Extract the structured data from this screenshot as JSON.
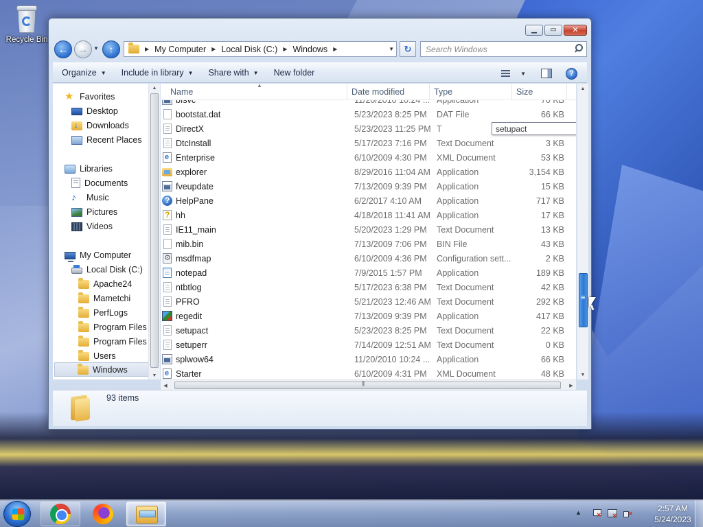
{
  "desktop": {
    "recycle_bin_label": "Recycle Bin"
  },
  "window": {
    "caption_buttons": {
      "minimize_icon": "minimize-icon",
      "maximize_icon": "maximize-icon",
      "close_icon": "close-icon"
    }
  },
  "navigation": {
    "breadcrumbs": [
      "My Computer",
      "Local Disk (C:)",
      "Windows"
    ],
    "search_placeholder": "Search Windows"
  },
  "toolbar": {
    "organize": "Organize",
    "include_in_library": "Include in library",
    "share_with": "Share with",
    "new_folder": "New folder"
  },
  "navpane": {
    "favorites": {
      "label": "Favorites",
      "items": [
        "Desktop",
        "Downloads",
        "Recent Places"
      ]
    },
    "libraries": {
      "label": "Libraries",
      "items": [
        "Documents",
        "Music",
        "Pictures",
        "Videos"
      ]
    },
    "computer": {
      "label": "My Computer",
      "disk": "Local Disk (C:)",
      "folders": [
        "Apache24",
        "Mametchi",
        "PerfLogs",
        "Program Files",
        "Program Files (",
        "Users",
        "Windows"
      ],
      "selected": "Windows"
    }
  },
  "columns": {
    "name": "Name",
    "date": "Date modified",
    "type": "Type",
    "size": "Size"
  },
  "files": [
    {
      "name": "bfsvc",
      "date": "11/20/2010 10:24 ...",
      "type": "Application",
      "size": "70 KB",
      "icon": "app"
    },
    {
      "name": "bootstat.dat",
      "date": "5/23/2023 8:25 PM",
      "type": "DAT File",
      "size": "66 KB",
      "icon": "blank"
    },
    {
      "name": "DirectX",
      "date": "5/23/2023 11:25 PM",
      "type": "T",
      "size": "",
      "icon": "text"
    },
    {
      "name": "DtcInstall",
      "date": "5/17/2023 7:16 PM",
      "type": "Text Document",
      "size": "3 KB",
      "icon": "text"
    },
    {
      "name": "Enterprise",
      "date": "6/10/2009 4:30 PM",
      "type": "XML Document",
      "size": "53 KB",
      "icon": "xml"
    },
    {
      "name": "explorer",
      "date": "8/29/2016 11:04 AM",
      "type": "Application",
      "size": "3,154 KB",
      "icon": "folder-exe"
    },
    {
      "name": "fveupdate",
      "date": "7/13/2009 9:39 PM",
      "type": "Application",
      "size": "15 KB",
      "icon": "app"
    },
    {
      "name": "HelpPane",
      "date": "6/2/2017 4:10 AM",
      "type": "Application",
      "size": "717 KB",
      "icon": "help"
    },
    {
      "name": "hh",
      "date": "4/18/2018 11:41 AM",
      "type": "Application",
      "size": "17 KB",
      "icon": "hh"
    },
    {
      "name": "IE11_main",
      "date": "5/20/2023 1:29 PM",
      "type": "Text Document",
      "size": "13 KB",
      "icon": "text"
    },
    {
      "name": "mib.bin",
      "date": "7/13/2009 7:06 PM",
      "type": "BIN File",
      "size": "43 KB",
      "icon": "blank"
    },
    {
      "name": "msdfmap",
      "date": "6/10/2009 4:36 PM",
      "type": "Configuration sett...",
      "size": "2 KB",
      "icon": "config"
    },
    {
      "name": "notepad",
      "date": "7/9/2015 1:57 PM",
      "type": "Application",
      "size": "189 KB",
      "icon": "notepad"
    },
    {
      "name": "ntbtlog",
      "date": "5/17/2023 6:38 PM",
      "type": "Text Document",
      "size": "42 KB",
      "icon": "text"
    },
    {
      "name": "PFRO",
      "date": "5/21/2023 12:46 AM",
      "type": "Text Document",
      "size": "292 KB",
      "icon": "text"
    },
    {
      "name": "regedit",
      "date": "7/13/2009 9:39 PM",
      "type": "Application",
      "size": "417 KB",
      "icon": "regedit"
    },
    {
      "name": "setupact",
      "date": "5/23/2023 8:25 PM",
      "type": "Text Document",
      "size": "22 KB",
      "icon": "text"
    },
    {
      "name": "setuperr",
      "date": "7/14/2009 12:51 AM",
      "type": "Text Document",
      "size": "0 KB",
      "icon": "text"
    },
    {
      "name": "splwow64",
      "date": "11/20/2010 10:24 ...",
      "type": "Application",
      "size": "66 KB",
      "icon": "app"
    },
    {
      "name": "Starter",
      "date": "6/10/2009 4:31 PM",
      "type": "XML Document",
      "size": "48 KB",
      "icon": "xml"
    }
  ],
  "tooltip": "setupact",
  "details": {
    "item_count": "93 items"
  },
  "taskbar": {
    "time": "2:57 AM",
    "date": "5/24/2023",
    "apps": [
      "chrome-icon",
      "firefox-icon",
      "explorer-icon"
    ]
  }
}
